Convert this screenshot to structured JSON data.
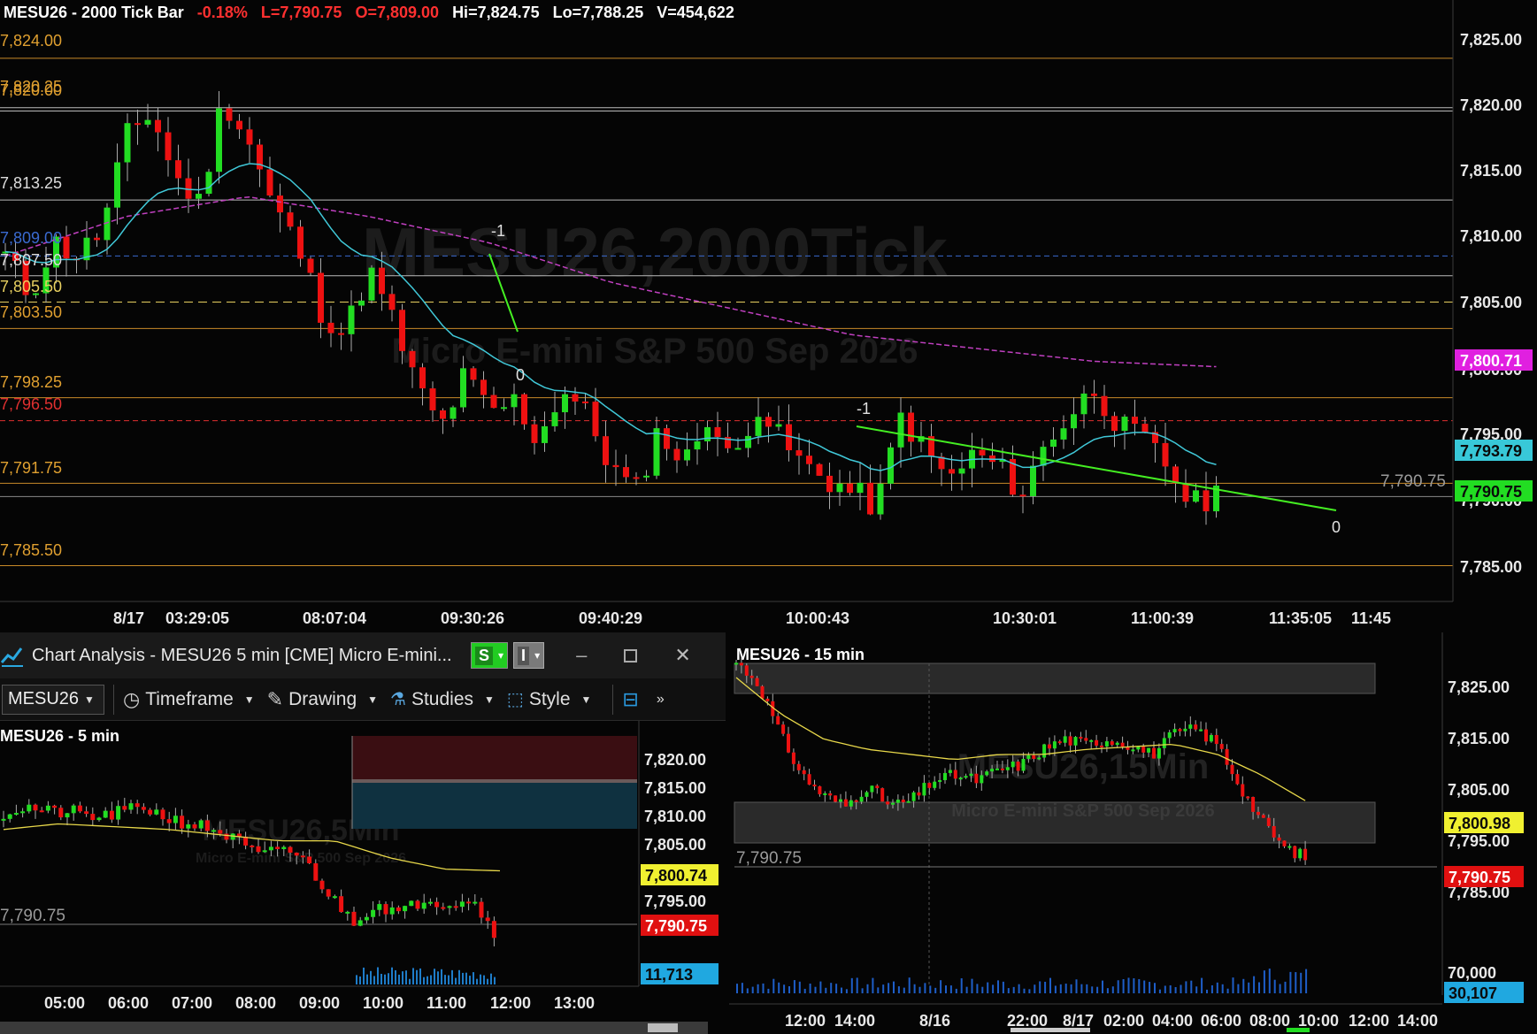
{
  "main": {
    "header": {
      "symbol_bar": "MESU26 - 2000 Tick Bar",
      "change": "-0.18%",
      "last": "L=7,790.75",
      "open": "O=7,809.00",
      "high": "Hi=7,824.75",
      "low": "Lo=7,788.25",
      "volume": "V=454,622"
    },
    "watermark_title": "MESU26,2000Tick",
    "watermark_subtitle": "Micro E-mini S&P 500 Sep 2026",
    "price_axis": [
      "7,825.00",
      "7,820.00",
      "7,815.00",
      "7,810.00",
      "7,805.00",
      "7,800.00",
      "7,795.00",
      "7,790.00",
      "7,785.00"
    ],
    "level_labels": [
      {
        "text": "7,824.00",
        "color": "#e0a030"
      },
      {
        "text": "7,820.25",
        "color": "#e0a030"
      },
      {
        "text": "7,820.00",
        "color": "#e0a030"
      },
      {
        "text": "7,813.25",
        "color": "#dddddd"
      },
      {
        "text": "7,809.00",
        "color": "#3a6ad0"
      },
      {
        "text": "7,807.50",
        "color": "#dddddd"
      },
      {
        "text": "7,805.50",
        "color": "#e8d060"
      },
      {
        "text": "7,803.50",
        "color": "#e0a030"
      },
      {
        "text": "7,798.25",
        "color": "#e0a030"
      },
      {
        "text": "7,796.50",
        "color": "#e03030"
      },
      {
        "text": "7,791.75",
        "color": "#e0a030"
      },
      {
        "text": "7,785.50",
        "color": "#e0a030"
      }
    ],
    "price_tags": {
      "ma_slow": "7,800.71",
      "ma_fast": "7,793.79",
      "last": "7,790.75"
    },
    "last_price_label": "7,790.75",
    "time_axis": [
      "8/17",
      "03:29:05",
      "08:07:04",
      "09:30:26",
      "09:40:29",
      "10:00:43",
      "10:30:01",
      "11:00:39",
      "11:35:05",
      "11:45"
    ],
    "markers": {
      "m1a": "-1",
      "z1": "0",
      "m1b": "-1",
      "z2": "0"
    },
    "colors": {
      "bull": "#22dd22",
      "bear": "#ee1111",
      "ma_fast": "#40c8d8",
      "ma_slow": "#c040c0",
      "trend": "#44ee22"
    }
  },
  "analysis": {
    "title": "Chart Analysis - MESU26 5 min [CME] Micro E-mini...",
    "badge_s": "S",
    "badge_i": "I",
    "toolbar": {
      "symbol": "MESU26",
      "timeframe": "Timeframe",
      "drawing": "Drawing",
      "studies": "Studies",
      "style": "Style"
    },
    "chart_title": "MESU26 - 5 min",
    "watermark_title": "MESU26,5Min",
    "watermark_subtitle": "Micro E-mini S&P 500 Sep 2026",
    "price_axis": [
      "7,820.00",
      "7,815.00",
      "7,810.00",
      "7,805.00",
      "7,800.00",
      "7,795.00"
    ],
    "price_tags": {
      "ma": "7,800.74",
      "last": "7,790.75",
      "volume": "11,713"
    },
    "last_price_label": "7,790.75",
    "time_axis": [
      "05:00",
      "06:00",
      "07:00",
      "08:00",
      "09:00",
      "10:00",
      "11:00",
      "12:00",
      "13:00"
    ]
  },
  "fifteen": {
    "chart_title": "MESU26 - 15 min",
    "watermark_title": "MESU26,15Min",
    "watermark_subtitle": "Micro E-mini S&P 500 Sep 2026",
    "price_axis": [
      "7,825.00",
      "7,815.00",
      "7,805.00",
      "7,795.00",
      "7,785.00",
      "70,000"
    ],
    "price_tags": {
      "ma": "7,800.98",
      "last": "7,790.75",
      "volume": "30,107"
    },
    "last_price_label": "7,790.75",
    "time_axis": [
      "12:00",
      "14:00",
      "8/16",
      "22:00",
      "8/17",
      "02:00",
      "04:00",
      "06:00",
      "08:00",
      "10:00",
      "12:00",
      "14:00"
    ]
  }
}
